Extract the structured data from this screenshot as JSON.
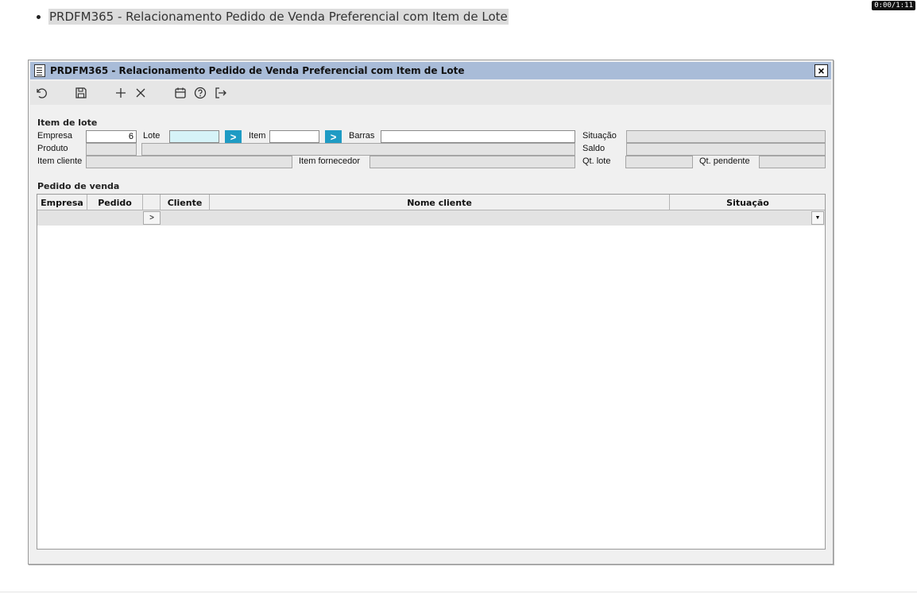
{
  "page": {
    "bullet_text": "PRDFM365 - Relacionamento Pedido de Venda Preferencial com Item de Lote",
    "timer": "0:00/1:11"
  },
  "window": {
    "title": "PRDFM365 - Relacionamento Pedido de Venda Preferencial com Item de Lote",
    "close_label": "×"
  },
  "toolbar": {
    "icons": [
      "undo-icon",
      "save-icon",
      "add-icon",
      "delete-icon",
      "calendar-icon",
      "help-icon",
      "exit-icon"
    ]
  },
  "item_lote": {
    "section_title": "Item de lote",
    "empresa_label": "Empresa",
    "empresa_value": "6",
    "lote_label": "Lote",
    "lote_value": "",
    "item_label": "Item",
    "item_value": "",
    "barras_label": "Barras",
    "barras_value": "",
    "situacao_label": "Situação",
    "produto_label": "Produto",
    "saldo_label": "Saldo",
    "item_cliente_label": "Item cliente",
    "item_fornecedor_label": "Item fornecedor",
    "qt_lote_label": "Qt. lote",
    "qt_pendente_label": "Qt. pendente",
    "go_symbol": ">"
  },
  "pedido_venda": {
    "section_title": "Pedido de venda",
    "columns": [
      "Empresa",
      "Pedido",
      "",
      "Cliente",
      "Nome cliente",
      "Situação"
    ],
    "row_pointer": ">",
    "dropdown_symbol": "▼"
  },
  "colors": {
    "titlebar": "#a9bcd8",
    "go_button": "#1e9bc4",
    "lote_field": "#d6f3f8"
  }
}
